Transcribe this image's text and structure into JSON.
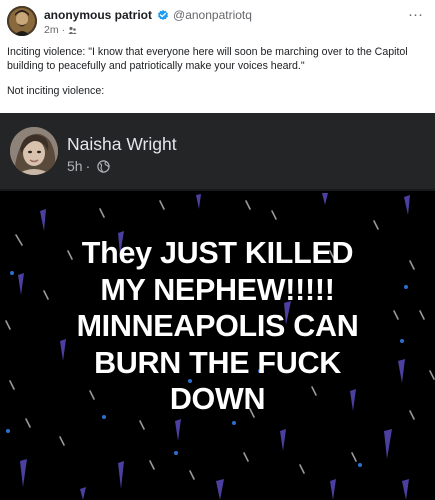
{
  "post": {
    "author_name": "anonymous patriot",
    "handle": "@anonpatriotq",
    "time": "2m",
    "separator": "·",
    "more_label": "···",
    "paragraphs": [
      "Inciting violence: \"I know that everyone here will soon be marching over to the Capitol building to peacefully and patriotically make your voices heard.\"",
      "Not inciting violence:"
    ],
    "icons": {
      "verified": "verified-badge-icon",
      "audience": "audience-icon",
      "more": "more-options-icon"
    },
    "colors": {
      "verified": "#1d9bf0"
    }
  },
  "embedded_post": {
    "author_name": "Naisha Wright",
    "time": "5h",
    "separator": "·",
    "icons": {
      "privacy": "globe-icon"
    },
    "story_text_lines": [
      "They JUST KILLED",
      "MY NEPHEW!!!!!",
      "MINNEAPOLIS CAN",
      "BURN THE FUCK",
      "DOWN"
    ],
    "colors": {
      "background": "#000000",
      "header": "#242526",
      "raindrop": "#4b3fa0"
    }
  }
}
